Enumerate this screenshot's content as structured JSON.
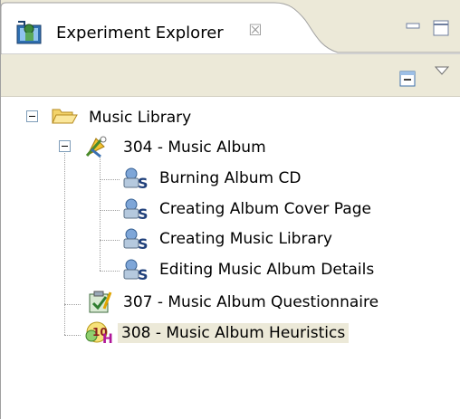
{
  "view": {
    "title": "Experiment Explorer",
    "close_glyph": "☒",
    "title_icon": "experiment-explorer-icon",
    "min_icon": "minimize-icon",
    "max_icon": "maximize-icon",
    "collapse_icon": "collapse-all-icon",
    "menu_icon": "view-menu-icon"
  },
  "tree": {
    "root": {
      "label": "Music Library",
      "icon": "folder-open-icon",
      "expanded": true
    },
    "experiment": {
      "label": "304 - Music Album",
      "icon": "experiment-icon",
      "expanded": true
    },
    "tasks": [
      {
        "label": "Burning Album CD",
        "icon": "task-scenario-icon"
      },
      {
        "label": "Creating Album Cover Page",
        "icon": "task-scenario-icon"
      },
      {
        "label": "Creating Music Library",
        "icon": "task-scenario-icon"
      },
      {
        "label": "Editing Music Album Details",
        "icon": "task-scenario-icon"
      }
    ],
    "siblings": [
      {
        "label": "307 - Music Album Questionnaire",
        "icon": "questionnaire-icon",
        "selected": false
      },
      {
        "label": "308 - Music Album Heuristics",
        "icon": "heuristics-icon",
        "selected": true
      }
    ]
  },
  "colors": {
    "chrome": "#ece9d8",
    "selection": "#ece9d8",
    "tree_line": "#a0a0a0",
    "toggle_border": "#7f9db9"
  }
}
